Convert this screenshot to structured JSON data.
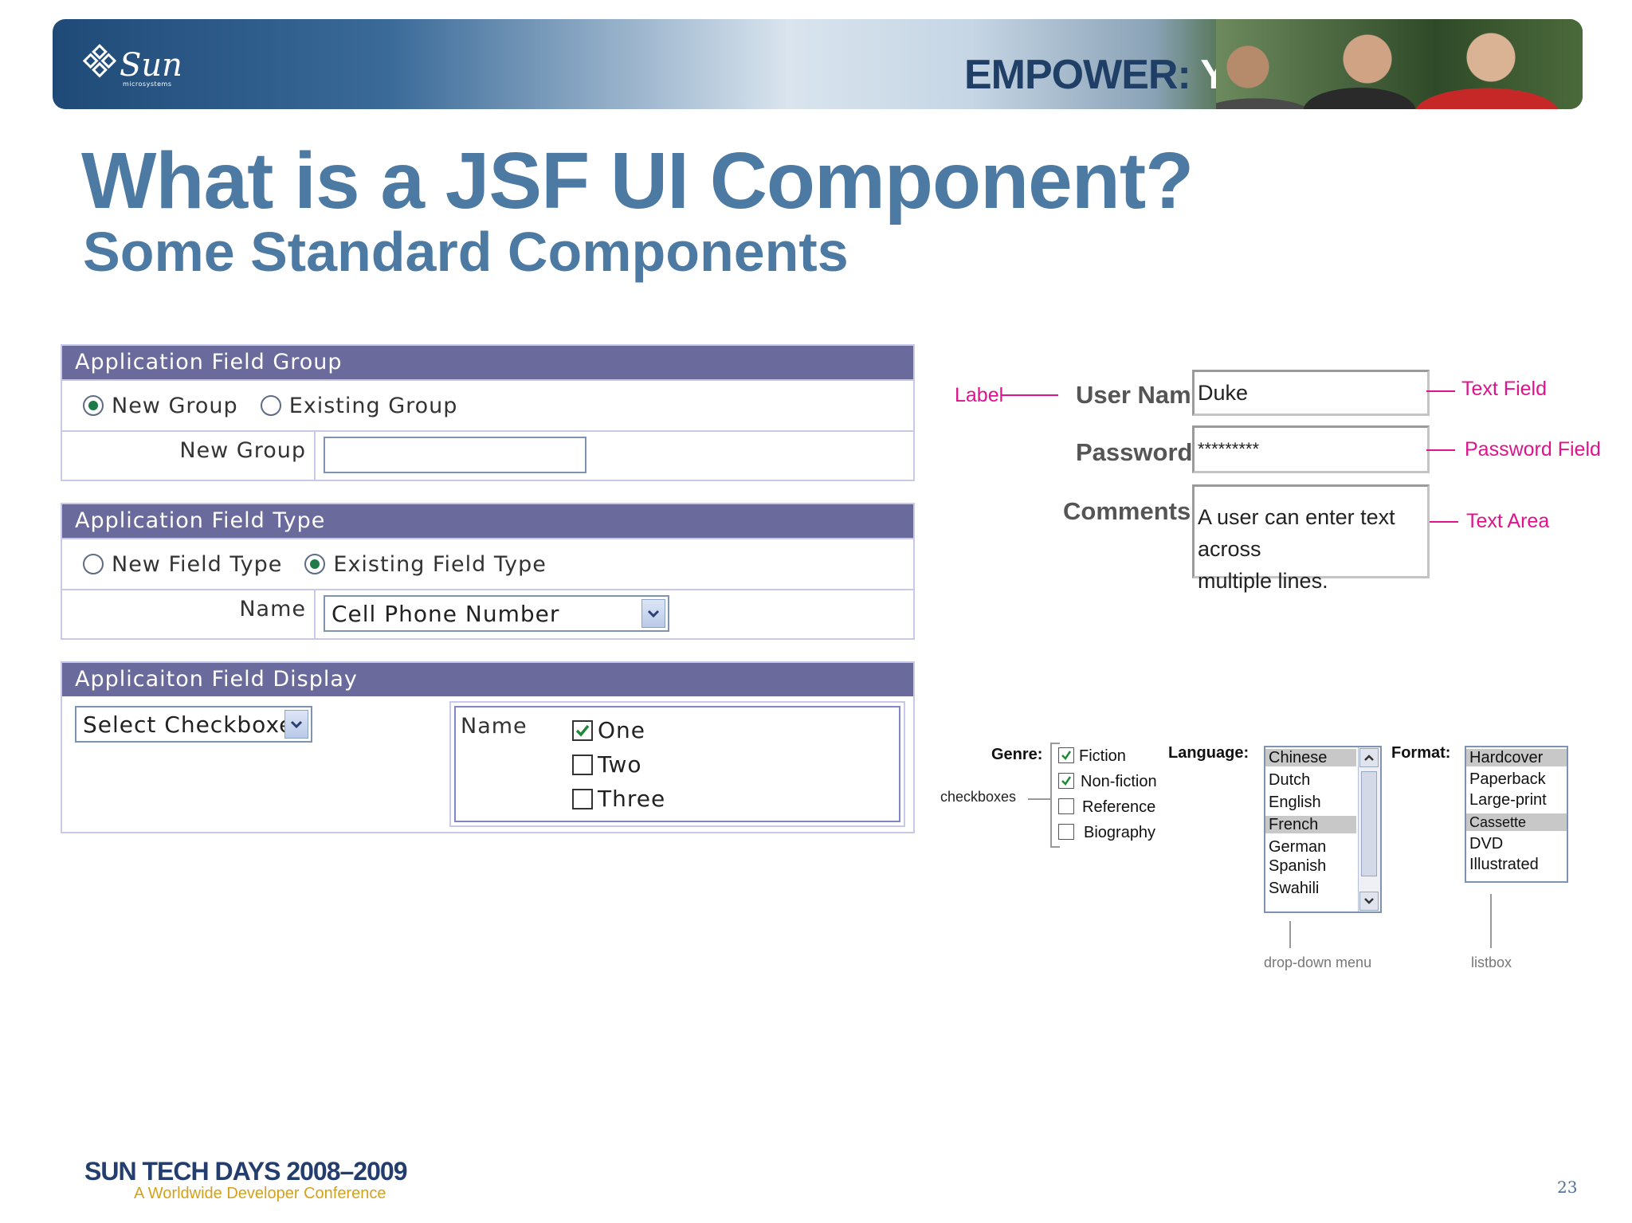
{
  "banner": {
    "logo_text": "Sun",
    "logo_subtext": "microsystems",
    "slogan_part1": "EMPOWER:",
    "slogan_part2": "YOU"
  },
  "title": "What is a JSF UI Component?",
  "subtitle": "Some Standard Components",
  "form_demo": {
    "group1": {
      "header": "Application Field Group",
      "radios": [
        {
          "label": "New Group",
          "selected": true
        },
        {
          "label": "Existing Group",
          "selected": false
        }
      ],
      "field_label": "New Group",
      "field_value": ""
    },
    "group2": {
      "header": "Application Field Type",
      "radios": [
        {
          "label": "New Field Type",
          "selected": false
        },
        {
          "label": "Existing Field Type",
          "selected": true
        }
      ],
      "field_label": "Name",
      "select_value": "Cell Phone Number"
    },
    "group3": {
      "header": "Applicaiton Field Display",
      "select_value": "Select Checkboxes",
      "checkbox_label": "Name",
      "checkboxes": [
        {
          "label": "One",
          "checked": true
        },
        {
          "label": "Two",
          "checked": false
        },
        {
          "label": "Three",
          "checked": false
        }
      ]
    }
  },
  "input_demo": {
    "callouts": {
      "label": "Label",
      "text_field": "Text Field",
      "password_field": "Password Field",
      "text_area": "Text Area"
    },
    "username_label": "User Name:",
    "username_value": "Duke",
    "password_label": "Password:",
    "password_value": "*********",
    "comments_label": "Comments:",
    "comments_line1": "A user can enter text across",
    "comments_line2": "multiple lines."
  },
  "selection_demo": {
    "genre_label": "Genre:",
    "genre_items": [
      {
        "label": "Fiction",
        "checked": true
      },
      {
        "label": "Non-fiction",
        "checked": true
      },
      {
        "label": "Reference",
        "checked": false
      },
      {
        "label": "Biography",
        "checked": false
      }
    ],
    "checkboxes_note": "checkboxes",
    "language_label": "Language:",
    "language_items": [
      {
        "label": "Chinese",
        "selected": true
      },
      {
        "label": "Dutch",
        "selected": false
      },
      {
        "label": "English",
        "selected": false
      },
      {
        "label": "French",
        "selected": true
      },
      {
        "label": "German",
        "selected": false
      },
      {
        "label": "Spanish",
        "selected": false
      },
      {
        "label": "Swahili",
        "selected": false
      }
    ],
    "dropdown_note": "drop-down menu",
    "format_label": "Format:",
    "format_items": [
      {
        "label": "Hardcover",
        "selected": true
      },
      {
        "label": "Paperback",
        "selected": false
      },
      {
        "label": "Large-print",
        "selected": false
      },
      {
        "label": "Cassette",
        "selected": true
      },
      {
        "label": "DVD",
        "selected": false
      },
      {
        "label": "Illustrated",
        "selected": false
      }
    ],
    "listbox_note": "listbox"
  },
  "footer": {
    "brand": "SUN TECH DAYS 2008–2009",
    "tagline": "A Worldwide Developer Conference",
    "page_number": "23"
  },
  "colors": {
    "title": "#4d7aa3",
    "panel_header": "#6a6a9c",
    "callout": "#e0138c",
    "footer_brand": "#233d6e",
    "footer_tagline": "#d4a21a"
  }
}
